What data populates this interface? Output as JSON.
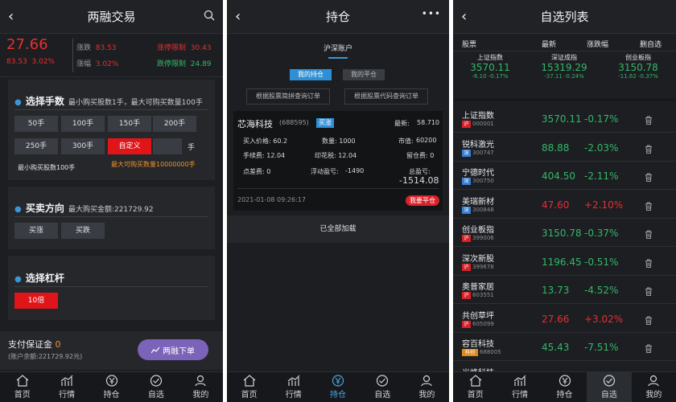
{
  "panel1": {
    "title": "两融交易",
    "price": "27.66",
    "sub_left": "83.53",
    "sub_pct": "3.02%",
    "change_label": "涨跌",
    "change_value": "83.53",
    "amp_label": "涨幅",
    "amp_value": "3.02%",
    "limit_up_label": "涨停限制",
    "limit_up_value": "30.43",
    "limit_down_label": "跌停限制",
    "limit_down_value": "24.89",
    "qty_title": "选择手数",
    "qty_sub": "最小购买股数1手，最大可购买数量100手",
    "qty_buttons": [
      "50手",
      "100手",
      "150手",
      "200手",
      "250手",
      "300手",
      "自定义"
    ],
    "custom_unit": "手",
    "min_note": "最小购买股数100手",
    "max_note": "最大可购买数量10000000手",
    "dir_title": "买卖方向",
    "dir_sub": "最大购买金额:221729.92",
    "dir_buttons": [
      "买涨",
      "买跌"
    ],
    "lev_title": "选择杠杆",
    "lev_button": "10倍",
    "pay_label": "支付保证金",
    "pay_value": "0",
    "balance": "(账户余额:221729.92元)",
    "order_button": "两融下单"
  },
  "panel2": {
    "title": "持仓",
    "account": "沪深账户",
    "tab_hold": "我的持仓",
    "tab_closed": "我的平仓",
    "query1": "根据股票简拼查询订单",
    "query2": "根据股票代码查询订单",
    "stock_name": "芯海科技",
    "stock_code": "(688595)",
    "direction": "买涨",
    "latest_label": "最新:",
    "latest_value": "58.710",
    "buy_price": "买入价格: 60.2",
    "quantity": "数量: 1000",
    "mkt_label": "市值:",
    "mkt_value": "60200",
    "fee": "手续费: 12.04",
    "stamp": "印花税: 12.04",
    "overnight": "留仓费: 0",
    "spread": "点差费: 0",
    "float_label": "浮动盈亏:",
    "float_value": "-1490",
    "total_label": "总盈亏:",
    "total_value": "-1514.08",
    "time": "2021-01-08 09:26:17",
    "close_button": "我要平仓",
    "loaded": "已全部加载"
  },
  "panel3": {
    "title": "自选列表",
    "cols": [
      "股票",
      "最新",
      "涨跌幅",
      "删自选"
    ],
    "indices": [
      {
        "name": "上证指数",
        "value": "3570.11",
        "change": "-6.10 -0.17%"
      },
      {
        "name": "深证成指",
        "value": "15319.29",
        "change": "-37.11 -0.24%"
      },
      {
        "name": "创业板指",
        "value": "3150.78",
        "change": "-11.62 -0.37%"
      }
    ],
    "rows": [
      {
        "name": "上证指数",
        "mk": "沪",
        "code": "000001",
        "price": "3570.11",
        "pct": "-0.17%",
        "up": false
      },
      {
        "name": "锐科激光",
        "mk": "深",
        "code": "300747",
        "price": "88.88",
        "pct": "-2.03%",
        "up": false
      },
      {
        "name": "宁德时代",
        "mk": "深",
        "code": "300750",
        "price": "404.50",
        "pct": "-2.11%",
        "up": false
      },
      {
        "name": "美瑞新材",
        "mk": "深",
        "code": "300848",
        "price": "47.60",
        "pct": "+2.10%",
        "up": true
      },
      {
        "name": "创业板指",
        "mk": "沪",
        "code": "399006",
        "price": "3150.78",
        "pct": "-0.37%",
        "up": false
      },
      {
        "name": "深次新股",
        "mk": "沪",
        "code": "399678",
        "price": "1196.45",
        "pct": "-0.51%",
        "up": false
      },
      {
        "name": "奥普家居",
        "mk": "沪",
        "code": "603551",
        "price": "13.73",
        "pct": "-4.52%",
        "up": false
      },
      {
        "name": "共创草坪",
        "mk": "沪",
        "code": "605099",
        "price": "27.66",
        "pct": "+3.02%",
        "up": true
      },
      {
        "name": "容百科技",
        "mk": "科创",
        "code": "688005",
        "price": "45.43",
        "pct": "-7.51%",
        "up": false
      },
      {
        "name": "光峰科技",
        "mk": "",
        "code": "",
        "price": "",
        "pct": "",
        "up": true
      }
    ]
  },
  "tabs": [
    "首页",
    "行情",
    "持仓",
    "自选",
    "我的"
  ],
  "colors": {
    "red": "#e5302f",
    "green": "#35b768",
    "blue": "#3a95d4",
    "bg": "#1c1e22"
  }
}
